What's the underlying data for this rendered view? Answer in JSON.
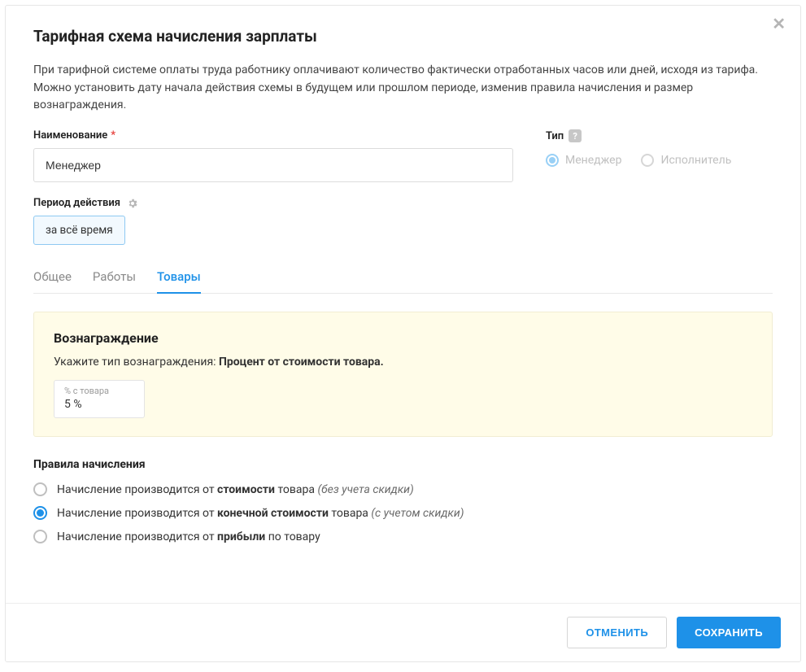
{
  "title": "Тарифная схема начисления зарплаты",
  "description": "При тарифной системе оплаты труда работнику оплачивают количество фактически отработанных часов или дней, исходя из тарифа. Можно установить дату начала действия схемы в будущем или прошлом периоде, изменив правила начисления и размер вознаграждения.",
  "form": {
    "name_label": "Наименование",
    "name_value": "Менеджер",
    "type_label": "Тип",
    "type_options": {
      "manager": "Менеджер",
      "performer": "Исполнитель"
    }
  },
  "period": {
    "label": "Период действия",
    "value": "за всё время"
  },
  "tabs": {
    "general": "Общее",
    "works": "Работы",
    "goods": "Товары"
  },
  "reward": {
    "title": "Вознаграждение",
    "subtitle_prefix": "Укажите тип вознаграждения: ",
    "subtitle_bold": "Процент от стоимости товара.",
    "percent_label": "% с товара",
    "percent_value": "5 %"
  },
  "rules": {
    "title": "Правила начисления",
    "r1": {
      "pre": "Начисление производится от ",
      "bold": "стоимости",
      "mid": " товара ",
      "italic": "(без учета скидки)"
    },
    "r2": {
      "pre": "Начисление производится от ",
      "bold": "конечной стоимости",
      "mid": " товара ",
      "italic": "(с учетом скидки)"
    },
    "r3": {
      "pre": "Начисление производится от ",
      "bold": "прибыли",
      "mid": " по товару",
      "italic": ""
    }
  },
  "footer": {
    "cancel": "ОТМЕНИТЬ",
    "save": "СОХРАНИТЬ"
  }
}
